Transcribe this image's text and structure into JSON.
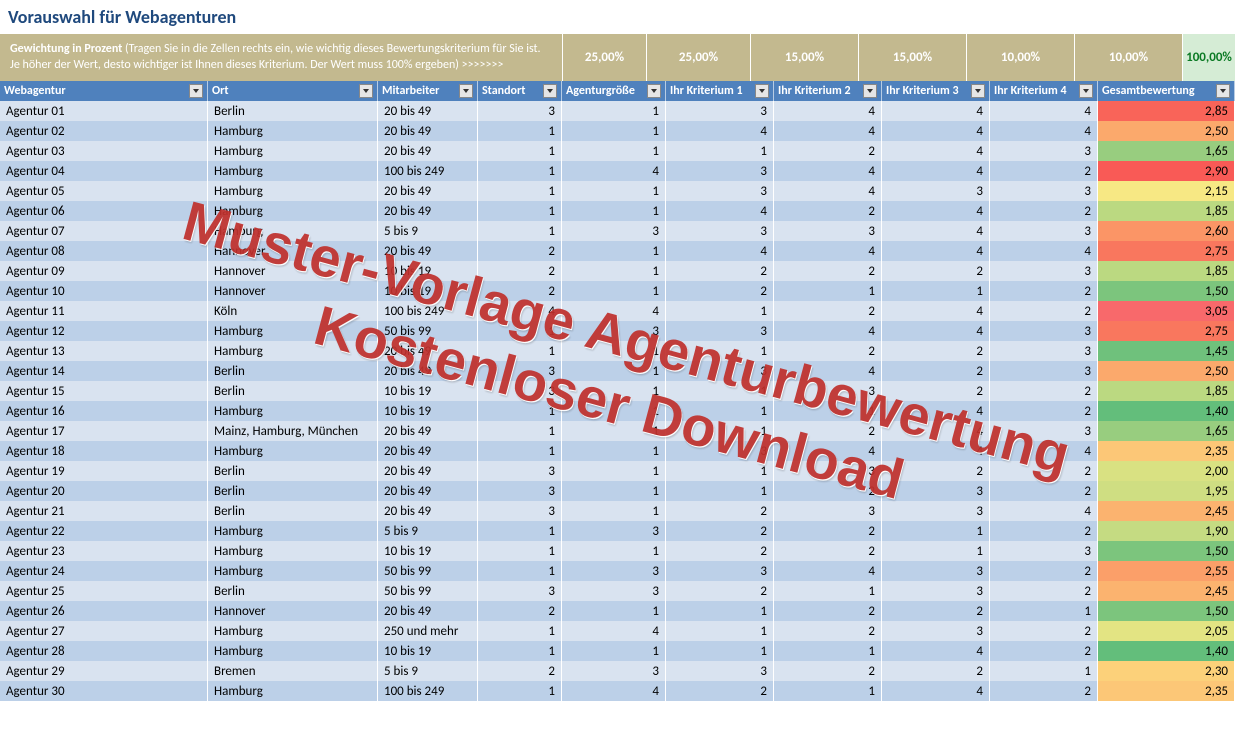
{
  "title": "Vorauswahl für Webagenturen",
  "weight_label_bold": "Gewichtung in Prozent",
  "weight_label_rest": " (Tragen Sie in die Zellen rechts ein, wie wichtig dieses Bewertungskriterium für Sie ist. Je höher der Wert, desto wichtiger ist Ihnen dieses Kriterium. Der Wert muss 100% ergeben) >>>>>>>",
  "weights": {
    "standort": "25,00%",
    "agentur": "25,00%",
    "k1": "15,00%",
    "k2": "15,00%",
    "k3": "10,00%",
    "k4": "10,00%",
    "total": "100,00%"
  },
  "headers": {
    "webagentur": "Webagentur",
    "ort": "Ort",
    "mitarbeiter": "Mitarbeiter",
    "standort": "Standort",
    "agentur": "Agenturgröße",
    "k1": "Ihr Kriterium 1",
    "k2": "Ihr Kriterium 2",
    "k3": "Ihr Kriterium 3",
    "k4": "Ihr Kriterium 4",
    "score": "Gesamtbewertung"
  },
  "watermark_line1": "Muster-Vorlage Agenturbewertung",
  "watermark_line2": "Kostenloser Download",
  "score_colors": {
    "1,40": "#63be7b",
    "1,45": "#6fc17c",
    "1,50": "#7cc57d",
    "1,65": "#98cd7f",
    "1,85": "#bbd981",
    "1,90": "#c5db82",
    "1,95": "#cfde82",
    "2,00": "#d9e182",
    "2,05": "#e3e483",
    "2,15": "#f7e884",
    "2,30": "#fcd17a",
    "2,35": "#fcc777",
    "2,45": "#fbb36f",
    "2,50": "#fba96c",
    "2,55": "#fb9f69",
    "2,60": "#fb9566",
    "2,75": "#f9775e",
    "2,85": "#f96459",
    "2,90": "#f95a56",
    "3,05": "#f8696b"
  },
  "rows": [
    {
      "a": "Agentur 01",
      "o": "Berlin",
      "m": "20 bis 49",
      "s": "3",
      "g": "1",
      "k1": "3",
      "k2": "4",
      "k3": "4",
      "k4": "4",
      "sc": "2,85"
    },
    {
      "a": "Agentur 02",
      "o": "Hamburg",
      "m": "20 bis 49",
      "s": "1",
      "g": "1",
      "k1": "4",
      "k2": "4",
      "k3": "4",
      "k4": "4",
      "sc": "2,50"
    },
    {
      "a": "Agentur 03",
      "o": "Hamburg",
      "m": "20 bis 49",
      "s": "1",
      "g": "1",
      "k1": "1",
      "k2": "2",
      "k3": "4",
      "k4": "3",
      "sc": "1,65"
    },
    {
      "a": "Agentur 04",
      "o": "Hamburg",
      "m": "100 bis 249",
      "s": "1",
      "g": "4",
      "k1": "3",
      "k2": "4",
      "k3": "4",
      "k4": "2",
      "sc": "2,90"
    },
    {
      "a": "Agentur 05",
      "o": "Hamburg",
      "m": "20 bis 49",
      "s": "1",
      "g": "1",
      "k1": "3",
      "k2": "4",
      "k3": "3",
      "k4": "3",
      "sc": "2,15"
    },
    {
      "a": "Agentur 06",
      "o": "Hamburg",
      "m": "20 bis 49",
      "s": "1",
      "g": "1",
      "k1": "4",
      "k2": "2",
      "k3": "4",
      "k4": "2",
      "sc": "1,85"
    },
    {
      "a": "Agentur 07",
      "o": "Hamburg",
      "m": "5 bis 9",
      "s": "1",
      "g": "3",
      "k1": "3",
      "k2": "3",
      "k3": "4",
      "k4": "3",
      "sc": "2,60"
    },
    {
      "a": "Agentur 08",
      "o": "Hannover",
      "m": "20 bis 49",
      "s": "2",
      "g": "1",
      "k1": "4",
      "k2": "4",
      "k3": "4",
      "k4": "4",
      "sc": "2,75"
    },
    {
      "a": "Agentur 09",
      "o": "Hannover",
      "m": "10 bis 19",
      "s": "2",
      "g": "1",
      "k1": "2",
      "k2": "2",
      "k3": "2",
      "k4": "3",
      "sc": "1,85"
    },
    {
      "a": "Agentur 10",
      "o": "Hannover",
      "m": "10 bis 19",
      "s": "2",
      "g": "1",
      "k1": "2",
      "k2": "1",
      "k3": "1",
      "k4": "2",
      "sc": "1,50"
    },
    {
      "a": "Agentur 11",
      "o": "Köln",
      "m": "100 bis 249",
      "s": "4",
      "g": "4",
      "k1": "1",
      "k2": "2",
      "k3": "4",
      "k4": "2",
      "sc": "3,05"
    },
    {
      "a": "Agentur 12",
      "o": "Hamburg",
      "m": "50 bis 99",
      "s": "1",
      "g": "3",
      "k1": "3",
      "k2": "4",
      "k3": "4",
      "k4": "3",
      "sc": "2,75"
    },
    {
      "a": "Agentur 13",
      "o": "Hamburg",
      "m": "20 bis 49",
      "s": "1",
      "g": "1",
      "k1": "1",
      "k2": "2",
      "k3": "2",
      "k4": "3",
      "sc": "1,45"
    },
    {
      "a": "Agentur 14",
      "o": "Berlin",
      "m": "20 bis 49",
      "s": "3",
      "g": "1",
      "k1": "3",
      "k2": "4",
      "k3": "2",
      "k4": "3",
      "sc": "2,50"
    },
    {
      "a": "Agentur 15",
      "o": "Berlin",
      "m": "10 bis 19",
      "s": "3",
      "g": "1",
      "k1": "1",
      "k2": "3",
      "k3": "2",
      "k4": "2",
      "sc": "1,85"
    },
    {
      "a": "Agentur 16",
      "o": "Hamburg",
      "m": "10 bis 19",
      "s": "1",
      "g": "1",
      "k1": "1",
      "k2": "1",
      "k3": "4",
      "k4": "2",
      "sc": "1,40"
    },
    {
      "a": "Agentur 17",
      "o": "Mainz, Hamburg, München",
      "m": "20 bis 49",
      "s": "1",
      "g": "1",
      "k1": "1",
      "k2": "2",
      "k3": "4",
      "k4": "3",
      "sc": "1,65"
    },
    {
      "a": "Agentur 18",
      "o": "Hamburg",
      "m": "20 bis 49",
      "s": "1",
      "g": "1",
      "k1": "3",
      "k2": "4",
      "k3": "4",
      "k4": "4",
      "sc": "2,35"
    },
    {
      "a": "Agentur 19",
      "o": "Berlin",
      "m": "20 bis 49",
      "s": "3",
      "g": "1",
      "k1": "1",
      "k2": "3",
      "k3": "2",
      "k4": "2",
      "sc": "2,00"
    },
    {
      "a": "Agentur 20",
      "o": "Berlin",
      "m": "20 bis 49",
      "s": "3",
      "g": "1",
      "k1": "1",
      "k2": "2",
      "k3": "3",
      "k4": "2",
      "sc": "1,95"
    },
    {
      "a": "Agentur 21",
      "o": "Berlin",
      "m": "20 bis 49",
      "s": "3",
      "g": "1",
      "k1": "2",
      "k2": "3",
      "k3": "3",
      "k4": "4",
      "sc": "2,45"
    },
    {
      "a": "Agentur 22",
      "o": "Hamburg",
      "m": "5 bis 9",
      "s": "1",
      "g": "3",
      "k1": "2",
      "k2": "2",
      "k3": "1",
      "k4": "2",
      "sc": "1,90"
    },
    {
      "a": "Agentur 23",
      "o": "Hamburg",
      "m": "10 bis 19",
      "s": "1",
      "g": "1",
      "k1": "2",
      "k2": "2",
      "k3": "1",
      "k4": "3",
      "sc": "1,50"
    },
    {
      "a": "Agentur 24",
      "o": "Hamburg",
      "m": "50 bis 99",
      "s": "1",
      "g": "3",
      "k1": "3",
      "k2": "4",
      "k3": "3",
      "k4": "2",
      "sc": "2,55"
    },
    {
      "a": "Agentur 25",
      "o": "Berlin",
      "m": "50 bis 99",
      "s": "3",
      "g": "3",
      "k1": "2",
      "k2": "1",
      "k3": "3",
      "k4": "2",
      "sc": "2,45"
    },
    {
      "a": "Agentur 26",
      "o": "Hannover",
      "m": "20 bis 49",
      "s": "2",
      "g": "1",
      "k1": "1",
      "k2": "2",
      "k3": "2",
      "k4": "1",
      "sc": "1,50"
    },
    {
      "a": "Agentur 27",
      "o": "Hamburg",
      "m": "250 und mehr",
      "s": "1",
      "g": "4",
      "k1": "1",
      "k2": "2",
      "k3": "3",
      "k4": "2",
      "sc": "2,05"
    },
    {
      "a": "Agentur 28",
      "o": "Hamburg",
      "m": "10 bis 19",
      "s": "1",
      "g": "1",
      "k1": "1",
      "k2": "1",
      "k3": "4",
      "k4": "2",
      "sc": "1,40"
    },
    {
      "a": "Agentur 29",
      "o": "Bremen",
      "m": "5 bis 9",
      "s": "2",
      "g": "3",
      "k1": "3",
      "k2": "2",
      "k3": "2",
      "k4": "1",
      "sc": "2,30"
    },
    {
      "a": "Agentur 30",
      "o": "Hamburg",
      "m": "100 bis 249",
      "s": "1",
      "g": "4",
      "k1": "2",
      "k2": "1",
      "k3": "4",
      "k4": "2",
      "sc": "2,35"
    }
  ]
}
